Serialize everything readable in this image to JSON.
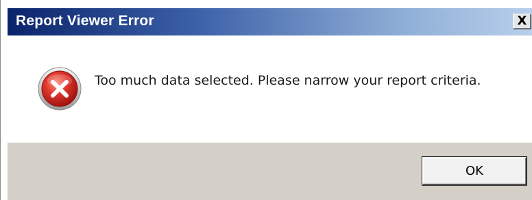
{
  "window": {
    "title": "Report Viewer Error",
    "close_label": "X"
  },
  "message": {
    "icon": "error-icon",
    "text": "Too much data selected. Please narrow your report criteria."
  },
  "buttons": {
    "ok_label": "OK"
  },
  "colors": {
    "titlebar_start": "#0a246a",
    "titlebar_end": "#b9cfeb",
    "footer": "#d4d0c8",
    "error_red": "#d42b2b"
  }
}
